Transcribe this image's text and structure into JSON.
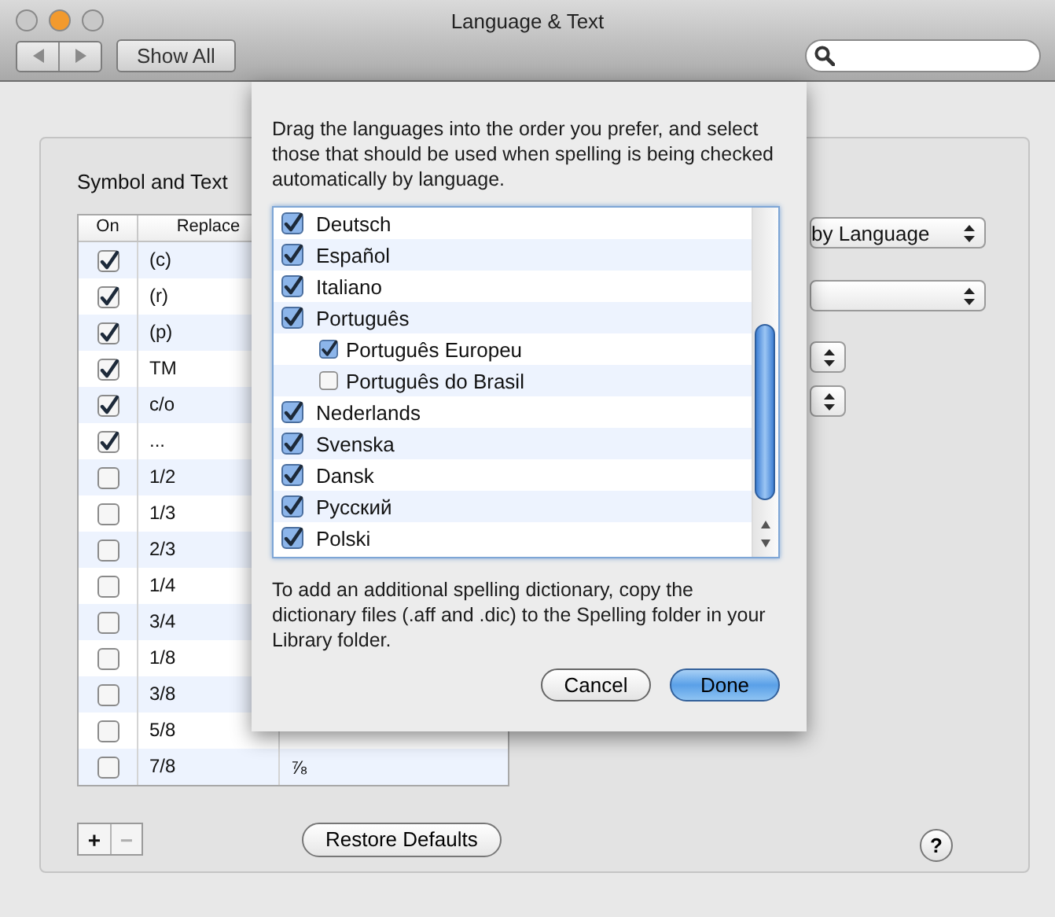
{
  "window": {
    "title": "Language & Text"
  },
  "toolbar": {
    "show_all": "Show All"
  },
  "panel": {
    "section_label": "Symbol and Text",
    "table": {
      "columns": [
        "On",
        "Replace"
      ],
      "rows": [
        {
          "checked": true,
          "replace": "(c)"
        },
        {
          "checked": true,
          "replace": "(r)"
        },
        {
          "checked": true,
          "replace": "(p)"
        },
        {
          "checked": true,
          "replace": "TM"
        },
        {
          "checked": true,
          "replace": "c/o"
        },
        {
          "checked": true,
          "replace": "..."
        },
        {
          "checked": false,
          "replace": "1/2"
        },
        {
          "checked": false,
          "replace": "1/3"
        },
        {
          "checked": false,
          "replace": "2/3"
        },
        {
          "checked": false,
          "replace": "1/4"
        },
        {
          "checked": false,
          "replace": "3/4"
        },
        {
          "checked": false,
          "replace": "1/8"
        },
        {
          "checked": false,
          "replace": "3/8"
        },
        {
          "checked": false,
          "replace": "5/8"
        },
        {
          "checked": false,
          "replace": "7/8",
          "column_3": "⅞"
        }
      ]
    },
    "add_button": {
      "label": "+",
      "disabled": false
    },
    "remove_button": {
      "label": "−",
      "disabled": true
    },
    "restore_button": "Restore Defaults",
    "help_button": "?",
    "popups": [
      {
        "kind": "wide",
        "value": "by Language"
      },
      {
        "kind": "wide"
      },
      {
        "kind": "narrow"
      },
      {
        "kind": "narrow"
      }
    ]
  },
  "sheet": {
    "intro": "Drag the languages into the order you prefer, and select those that should be used when spelling is being checked automatically by language.",
    "languages": [
      {
        "name": "Deutsch",
        "checked": true
      },
      {
        "name": "Español",
        "checked": true
      },
      {
        "name": "Italiano",
        "checked": true
      },
      {
        "name": "Português",
        "checked": true,
        "children": [
          {
            "name": "Português Europeu",
            "checked": true
          },
          {
            "name": "Português do Brasil",
            "checked": false
          }
        ]
      },
      {
        "name": "Nederlands",
        "checked": true
      },
      {
        "name": "Svenska",
        "checked": true
      },
      {
        "name": "Dansk",
        "checked": true
      },
      {
        "name": "Русский",
        "checked": true
      },
      {
        "name": "Polski",
        "checked": true
      }
    ],
    "note": "To add an additional spelling dictionary, copy the dictionary files (.aff and .dic) to the Spelling folder in your Library folder.",
    "buttons": [
      {
        "label": "Cancel",
        "default": false
      },
      {
        "label": "Done",
        "default": true
      }
    ]
  }
}
